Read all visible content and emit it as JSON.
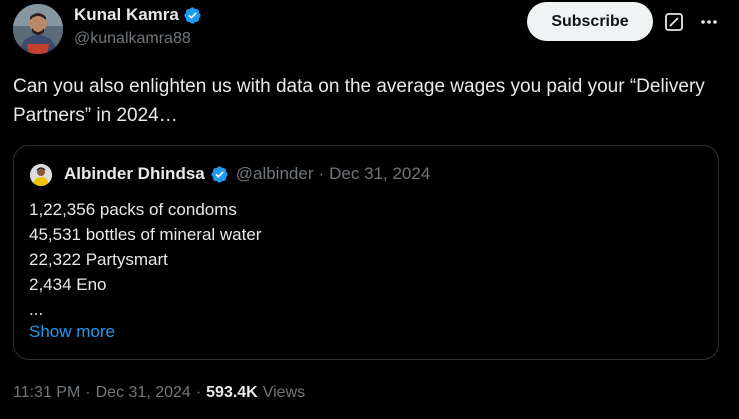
{
  "author": {
    "display_name": "Kunal Kamra",
    "handle": "@kunalkamra88"
  },
  "actions": {
    "subscribe_label": "Subscribe"
  },
  "post": {
    "text": "Can you also enlighten us with data on the average wages you paid your “Delivery Partners” in 2024…"
  },
  "quoted_post": {
    "display_name": "Albinder Dhindsa",
    "handle": "@albinder",
    "separator": "·",
    "date": "Dec 31, 2024",
    "lines": [
      "1,22,356 packs of condoms",
      "45,531 bottles of mineral water",
      "22,322 Partysmart",
      "2,434 Eno",
      "..."
    ],
    "show_more_label": "Show more"
  },
  "footer": {
    "time": "11:31 PM",
    "date": "Dec 31, 2024",
    "separator": "·",
    "views_count": "593.4K",
    "views_label": "Views"
  },
  "colors": {
    "background": "#000000",
    "text_primary": "#e7e9ea",
    "text_secondary": "#71767b",
    "accent_blue": "#1d9bf0",
    "border": "#2f3336"
  },
  "icons": {
    "verified": "verified-badge-icon",
    "grok": "grok-icon",
    "more": "more-options-icon"
  }
}
